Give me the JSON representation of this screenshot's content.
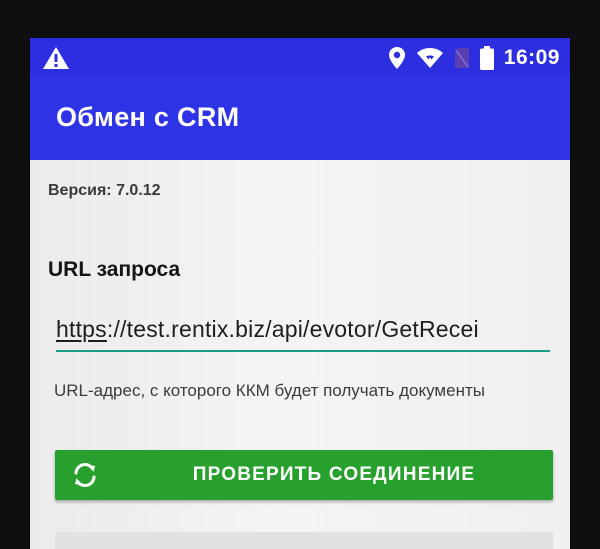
{
  "statusbar": {
    "time": "16:09",
    "icons": [
      "warning-icon",
      "location-icon",
      "wifi-icon",
      "no-sim-icon",
      "battery-icon"
    ],
    "color": "#2d2ee0"
  },
  "appbar": {
    "title": "Обмен с CRM",
    "color": "#2f33e6"
  },
  "content": {
    "version_label": "Версия: 7.0.12",
    "url_label": "URL запроса",
    "url_value": {
      "scheme": "https",
      "rest": "://test.rentix.biz/api/evotor/GetRecei"
    },
    "url_hint": "URL-адрес, с которого ККМ будет получать документы",
    "check_button_label": "ПРОВЕРИТЬ СОЕДИНЕНИЕ",
    "check_button_icon": "refresh-icon",
    "accent_color": "#1a9c86",
    "button_color": "#27a02e"
  }
}
